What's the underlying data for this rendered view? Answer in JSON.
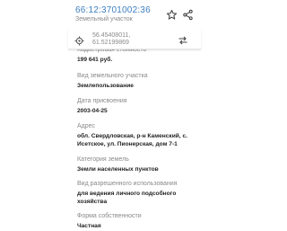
{
  "header": {
    "cadastral_number": "66:12:3701002:36",
    "subtitle": "Земельный участок",
    "favorite_icon": "star-outline-icon",
    "share_icon": "share-icon"
  },
  "coord_bar": {
    "lat": "56.45408011,",
    "lon": "61.52199869",
    "locate_icon": "crosshair-icon",
    "swap_icon": "swap-arrows-icon"
  },
  "fields": {
    "cut_label": "Кадастровая стоимость",
    "cost_value": "199 641 руб.",
    "use_type_label": "Вид земельного участка",
    "use_type_value": "Землепользование",
    "date_label": "Дата присвоения",
    "date_value": "2003-04-25",
    "address_label": "Адрес",
    "address_line1": "обл. Свердловская, р-н Каменский, с.",
    "address_line2": "Исетское, ул. Пионерская, дом 7-1",
    "category_label": "Категория земель",
    "category_value": "Земли населенных пунктов",
    "permitted_label": "Вид разрешенного использования",
    "permitted_line1": "для ведения личного подсобного",
    "permitted_line2": "хозяйства",
    "ownership_label": "Форма собственности",
    "ownership_value": "Частная"
  },
  "colors": {
    "accent": "#3d7fc1",
    "label": "#8a8a8a",
    "text": "#1f1f1f"
  }
}
